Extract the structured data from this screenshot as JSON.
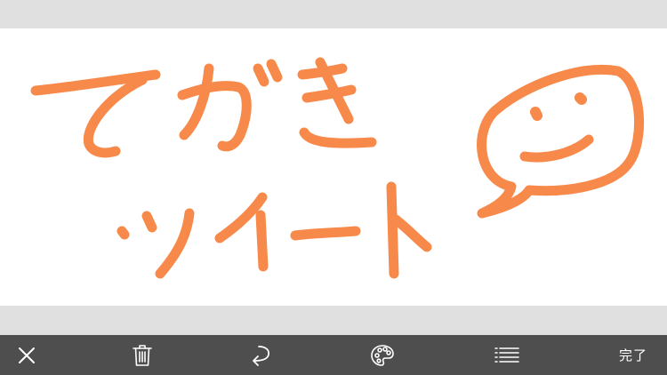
{
  "canvas": {
    "stroke_color": "#f7894a",
    "background_color": "#ffffff"
  },
  "toolbar": {
    "background_color": "#4e4e4e",
    "icon_color": "#ffffff",
    "buttons": [
      {
        "name": "close",
        "icon": "close-icon"
      },
      {
        "name": "delete",
        "icon": "trash-icon"
      },
      {
        "name": "undo",
        "icon": "undo-arrow-icon"
      },
      {
        "name": "color",
        "icon": "palette-icon"
      },
      {
        "name": "line-width",
        "icon": "list-lines-icon"
      }
    ],
    "done_label": "完了"
  }
}
